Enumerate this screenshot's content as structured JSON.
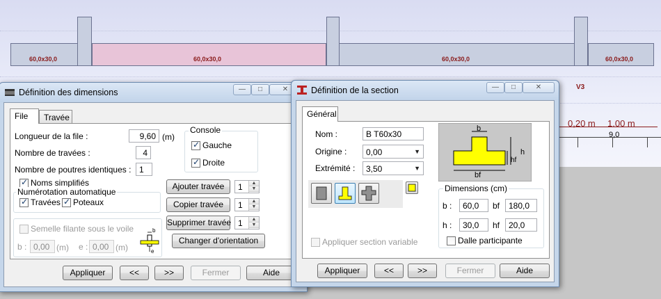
{
  "drawing": {
    "beam_labels": [
      "60,0x30,0",
      "60,0x30,0",
      "60,0x30,0",
      "60,0x30,0"
    ],
    "column_label": "V3",
    "ruler_text_1": "0,20 m",
    "ruler_text_2": "1.00 m",
    "scale_value": "9,0",
    "colors": {
      "beam": "#c8cfe0",
      "beam_selected": "#e8c4d8",
      "label": "#8a1b1b"
    }
  },
  "dim_window": {
    "title": "Définition des dimensions",
    "icon": "beam-icon",
    "tabs": [
      "File",
      "Travée"
    ],
    "longueur_label": "Longueur de la file :",
    "longueur_value": "9,60",
    "longueur_unit": "(m)",
    "nb_travees_label": "Nombre de travées :",
    "nb_travees_value": "4",
    "nb_poutres_label": "Nombre de poutres identiques :",
    "nb_poutres_value": "1",
    "noms_simplifies": "Noms simplifiés",
    "numerotation_title": "Numérotation automatique",
    "travees_check": "Travées",
    "poteaux_check": "Poteaux",
    "console_title": "Console",
    "gauche": "Gauche",
    "droite": "Droite",
    "ajouter": "Ajouter travée",
    "copier": "Copier travée",
    "supprimer": "Supprimer travée",
    "orientation": "Changer d'orientation",
    "spin_values": [
      "1",
      "1",
      "1"
    ],
    "semelle": "Semelle filante sous le voile",
    "b_label": "b :",
    "b_value": "0,00",
    "b_unit": "(m)",
    "e_label": "e :",
    "e_value": "0,00",
    "e_unit": "(m)",
    "fig_b": "b",
    "fig_e": "e",
    "appliquer": "Appliquer",
    "prev": "<<",
    "next": ">>",
    "fermer": "Fermer",
    "aide": "Aide"
  },
  "sec_window": {
    "title": "Définition de la section",
    "icon": "section-icon",
    "tab": "Général",
    "nom_label": "Nom :",
    "nom_value": "B T60x30",
    "origine_label": "Origine :",
    "origine_value": "0,00",
    "extremite_label": "Extrémité :",
    "extremite_value": "3,50",
    "shapes": [
      "rectangle-icon",
      "t-section-icon",
      "cross-section-icon"
    ],
    "appliquer_variable": "Appliquer section variable",
    "fig_b": "b",
    "fig_h": "h",
    "fig_hf": "hf",
    "fig_bf": "bf",
    "dimensions_title": "Dimensions (cm)",
    "b_label": "b :",
    "b_value": "60,0",
    "bf_label": "bf",
    "bf_value": "180,0",
    "h_label": "h :",
    "h_value": "30,0",
    "hf_label": "hf",
    "hf_value": "20,0",
    "dalle": "Dalle participante",
    "appliquer": "Appliquer",
    "prev": "<<",
    "next": ">>",
    "fermer": "Fermer",
    "aide": "Aide",
    "section_color": "#ffff00"
  }
}
